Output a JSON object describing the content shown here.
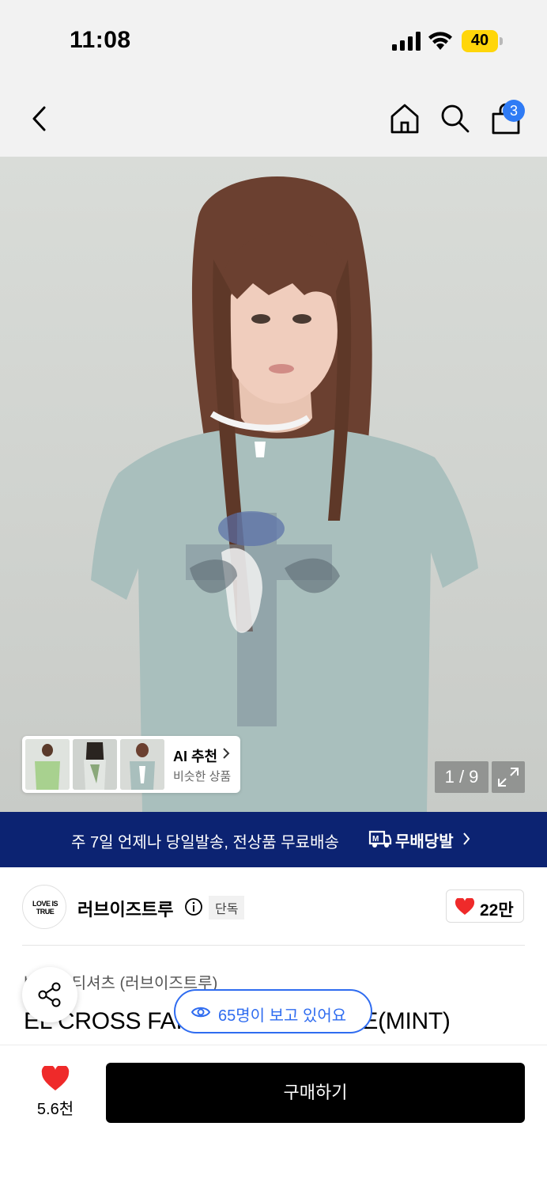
{
  "status_bar": {
    "time": "11:08",
    "battery": "40"
  },
  "nav": {
    "cart_count": "3",
    "icons": [
      "back-icon",
      "home-icon",
      "search-icon",
      "cart-icon"
    ]
  },
  "gallery": {
    "counter": "1 / 9",
    "ai_recommend": {
      "title": "AI 추천",
      "subtitle": "비슷한 상품"
    }
  },
  "promo": {
    "text": "주 7일 언제나 당일발송, 전상품 무료배송",
    "brand": "무배당발"
  },
  "brand": {
    "name": "러브이즈트루",
    "tag": "단독",
    "likes": "22만",
    "logo_text": "LOVE IS TRUE"
  },
  "product": {
    "category": "반소매 티셔츠 (러브이즈트루)",
    "title": "EL CROSS FAI",
    "title_tail": "E(MINT)",
    "viewers": "65명이 보고 있어요",
    "wish_count": "5.6천",
    "buy_label": "구매하기"
  },
  "colors": {
    "accent_blue": "#2f6cf0",
    "promo_navy": "#0c2372",
    "heart_red": "#ef2a2a",
    "badge_blue": "#2f7bf5"
  }
}
